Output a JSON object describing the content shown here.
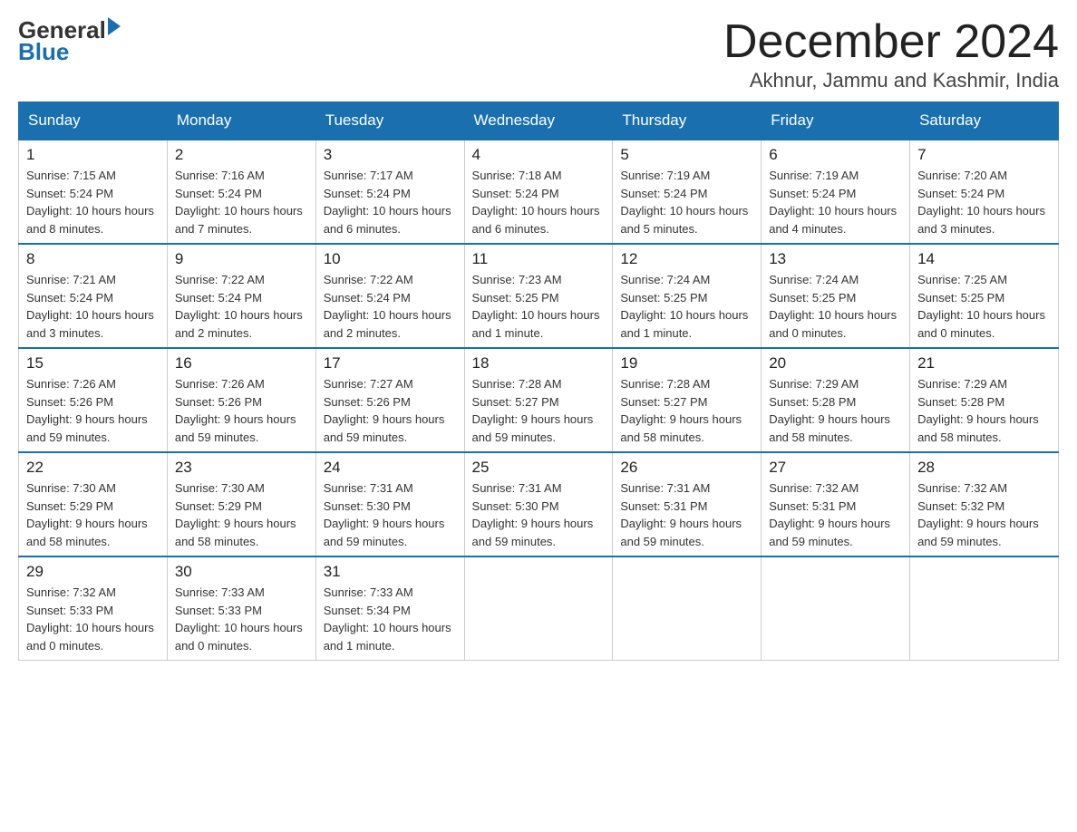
{
  "logo": {
    "line1": "General",
    "arrow": "►",
    "line2": "Blue"
  },
  "title": {
    "month_year": "December 2024",
    "location": "Akhnur, Jammu and Kashmir, India"
  },
  "days_of_week": [
    "Sunday",
    "Monday",
    "Tuesday",
    "Wednesday",
    "Thursday",
    "Friday",
    "Saturday"
  ],
  "weeks": [
    [
      {
        "day": "1",
        "sunrise": "7:15 AM",
        "sunset": "5:24 PM",
        "daylight": "10 hours and 8 minutes."
      },
      {
        "day": "2",
        "sunrise": "7:16 AM",
        "sunset": "5:24 PM",
        "daylight": "10 hours and 7 minutes."
      },
      {
        "day": "3",
        "sunrise": "7:17 AM",
        "sunset": "5:24 PM",
        "daylight": "10 hours and 6 minutes."
      },
      {
        "day": "4",
        "sunrise": "7:18 AM",
        "sunset": "5:24 PM",
        "daylight": "10 hours and 6 minutes."
      },
      {
        "day": "5",
        "sunrise": "7:19 AM",
        "sunset": "5:24 PM",
        "daylight": "10 hours and 5 minutes."
      },
      {
        "day": "6",
        "sunrise": "7:19 AM",
        "sunset": "5:24 PM",
        "daylight": "10 hours and 4 minutes."
      },
      {
        "day": "7",
        "sunrise": "7:20 AM",
        "sunset": "5:24 PM",
        "daylight": "10 hours and 3 minutes."
      }
    ],
    [
      {
        "day": "8",
        "sunrise": "7:21 AM",
        "sunset": "5:24 PM",
        "daylight": "10 hours and 3 minutes."
      },
      {
        "day": "9",
        "sunrise": "7:22 AM",
        "sunset": "5:24 PM",
        "daylight": "10 hours and 2 minutes."
      },
      {
        "day": "10",
        "sunrise": "7:22 AM",
        "sunset": "5:24 PM",
        "daylight": "10 hours and 2 minutes."
      },
      {
        "day": "11",
        "sunrise": "7:23 AM",
        "sunset": "5:25 PM",
        "daylight": "10 hours and 1 minute."
      },
      {
        "day": "12",
        "sunrise": "7:24 AM",
        "sunset": "5:25 PM",
        "daylight": "10 hours and 1 minute."
      },
      {
        "day": "13",
        "sunrise": "7:24 AM",
        "sunset": "5:25 PM",
        "daylight": "10 hours and 0 minutes."
      },
      {
        "day": "14",
        "sunrise": "7:25 AM",
        "sunset": "5:25 PM",
        "daylight": "10 hours and 0 minutes."
      }
    ],
    [
      {
        "day": "15",
        "sunrise": "7:26 AM",
        "sunset": "5:26 PM",
        "daylight": "9 hours and 59 minutes."
      },
      {
        "day": "16",
        "sunrise": "7:26 AM",
        "sunset": "5:26 PM",
        "daylight": "9 hours and 59 minutes."
      },
      {
        "day": "17",
        "sunrise": "7:27 AM",
        "sunset": "5:26 PM",
        "daylight": "9 hours and 59 minutes."
      },
      {
        "day": "18",
        "sunrise": "7:28 AM",
        "sunset": "5:27 PM",
        "daylight": "9 hours and 59 minutes."
      },
      {
        "day": "19",
        "sunrise": "7:28 AM",
        "sunset": "5:27 PM",
        "daylight": "9 hours and 58 minutes."
      },
      {
        "day": "20",
        "sunrise": "7:29 AM",
        "sunset": "5:28 PM",
        "daylight": "9 hours and 58 minutes."
      },
      {
        "day": "21",
        "sunrise": "7:29 AM",
        "sunset": "5:28 PM",
        "daylight": "9 hours and 58 minutes."
      }
    ],
    [
      {
        "day": "22",
        "sunrise": "7:30 AM",
        "sunset": "5:29 PM",
        "daylight": "9 hours and 58 minutes."
      },
      {
        "day": "23",
        "sunrise": "7:30 AM",
        "sunset": "5:29 PM",
        "daylight": "9 hours and 58 minutes."
      },
      {
        "day": "24",
        "sunrise": "7:31 AM",
        "sunset": "5:30 PM",
        "daylight": "9 hours and 59 minutes."
      },
      {
        "day": "25",
        "sunrise": "7:31 AM",
        "sunset": "5:30 PM",
        "daylight": "9 hours and 59 minutes."
      },
      {
        "day": "26",
        "sunrise": "7:31 AM",
        "sunset": "5:31 PM",
        "daylight": "9 hours and 59 minutes."
      },
      {
        "day": "27",
        "sunrise": "7:32 AM",
        "sunset": "5:31 PM",
        "daylight": "9 hours and 59 minutes."
      },
      {
        "day": "28",
        "sunrise": "7:32 AM",
        "sunset": "5:32 PM",
        "daylight": "9 hours and 59 minutes."
      }
    ],
    [
      {
        "day": "29",
        "sunrise": "7:32 AM",
        "sunset": "5:33 PM",
        "daylight": "10 hours and 0 minutes."
      },
      {
        "day": "30",
        "sunrise": "7:33 AM",
        "sunset": "5:33 PM",
        "daylight": "10 hours and 0 minutes."
      },
      {
        "day": "31",
        "sunrise": "7:33 AM",
        "sunset": "5:34 PM",
        "daylight": "10 hours and 1 minute."
      },
      null,
      null,
      null,
      null
    ]
  ],
  "labels": {
    "sunrise": "Sunrise:",
    "sunset": "Sunset:",
    "daylight": "Daylight:"
  }
}
